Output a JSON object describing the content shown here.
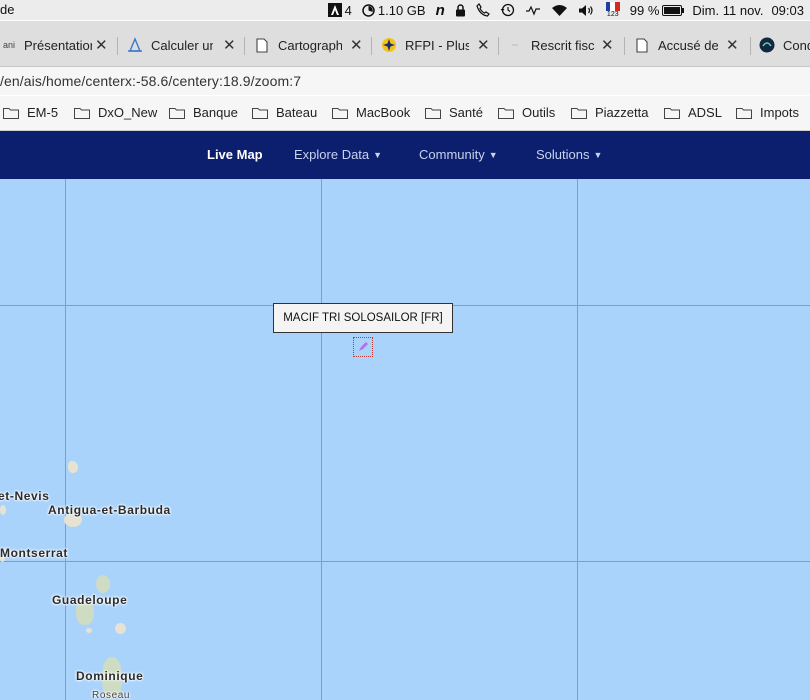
{
  "menubar": {
    "app_fragment": "de",
    "adobe_count": "4",
    "memory": "1.10 GB",
    "battery": "99 %",
    "datetime_day": "Dim. 11 nov.",
    "datetime_time": "09:03",
    "flag_code": "123"
  },
  "tabs": [
    {
      "label": "Présentation",
      "favicon": "ani-logo"
    },
    {
      "label": "Calculer un",
      "favicon": "lighthouse-icon"
    },
    {
      "label": "Cartographie",
      "favicon": "document-icon"
    },
    {
      "label": "RFPI - Plus",
      "favicon": "rfpi-logo"
    },
    {
      "label": "Rescrit fiscal",
      "favicon": "french-flag-icon"
    },
    {
      "label": "Accusé de",
      "favicon": "document-icon"
    },
    {
      "label": "Cond",
      "favicon": "wave-logo"
    }
  ],
  "address": {
    "url": "/en/ais/home/centerx:-58.6/centery:18.9/zoom:7"
  },
  "bookmarks": [
    "EM-5",
    "DxO_New",
    "Banque",
    "Bateau",
    "MacBook",
    "Santé",
    "Outils",
    "Piazzetta",
    "ADSL",
    "Impots"
  ],
  "nav": {
    "live_map": "Live Map",
    "explore_data": "Explore Data",
    "community": "Community",
    "solutions": "Solutions"
  },
  "map": {
    "tooltip": "MACIF TRI SOLOSAILOR [FR]",
    "labels": {
      "nevis": "et-Nevis",
      "antigua": "Antigua-et-Barbuda",
      "montserrat": "Montserrat",
      "guadeloupe": "Guadeloupe",
      "dominique": "Dominique",
      "roseau": "Roseau"
    },
    "colors": {
      "sea": "#aad3fb",
      "nav_bg": "#0b1f6e",
      "marker": "#c0392b",
      "vessel": "#b56cf0"
    }
  }
}
